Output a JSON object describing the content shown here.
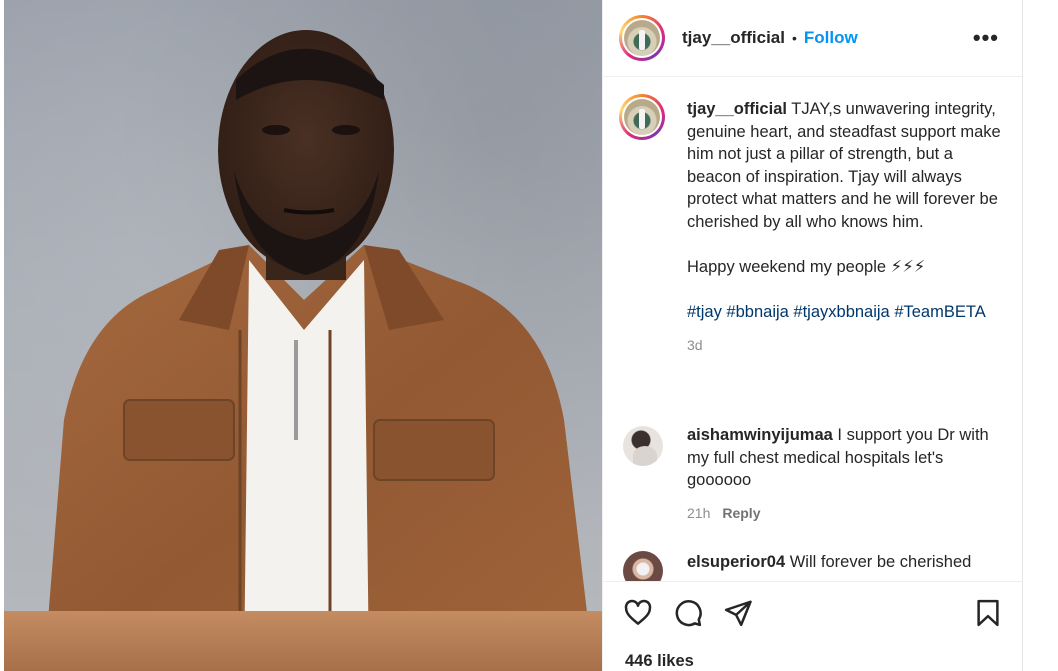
{
  "post": {
    "username": "tjay__official",
    "dot": "•",
    "follow_label": "Follow",
    "more_label": "•••",
    "likes": "446 likes"
  },
  "caption": {
    "username": "tjay__official",
    "text": "TJAY,s unwavering integrity, genuine heart, and steadfast support make him not just a pillar of strength, but a beacon of inspiration. Tjay will always protect what matters and he will forever be cherished by all who knows him.",
    "greeting": "Happy weekend my people ⚡⚡⚡",
    "hashtags": "#tjay #bbnaija #tjayxbbnaija #TeamBETA",
    "time": "3d"
  },
  "comments": [
    {
      "username": "aishamwinyijumaa",
      "text": "I support you Dr with my full chest medical hospitals let's goooooo",
      "time": "21h",
      "reply_label": "Reply",
      "avatar_icon": "user-avatar"
    },
    {
      "username": "elsuperior04",
      "text": "Will forever be cherished",
      "avatar_icon": "user-avatar"
    }
  ],
  "actions": {
    "like_icon": "heart-icon",
    "comment_icon": "comment-icon",
    "share_icon": "send-icon",
    "save_icon": "bookmark-icon"
  },
  "colors": {
    "follow": "#0095f6",
    "hashtag": "#00376b",
    "meta": "#8e8e8e",
    "text": "#262626"
  }
}
